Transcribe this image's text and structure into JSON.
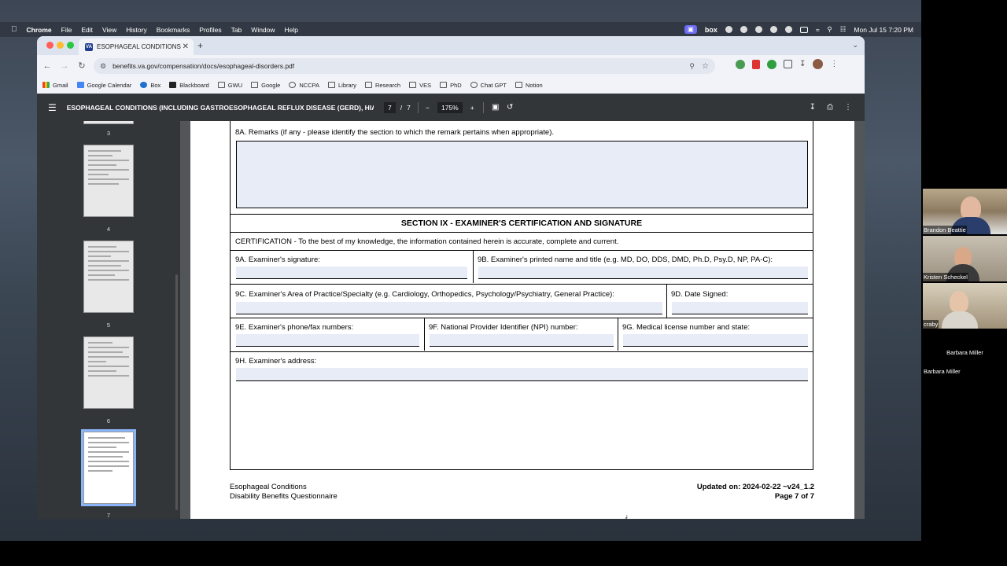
{
  "mac_menubar": {
    "app": "Chrome",
    "menus": [
      "File",
      "Edit",
      "View",
      "History",
      "Bookmarks",
      "Profiles",
      "Tab",
      "Window",
      "Help"
    ],
    "clock": "Mon Jul 15  7:20 PM",
    "box_label": "box"
  },
  "browser": {
    "tab_title": "ESOPHAGEAL CONDITIONS",
    "tab_favicon_text": "VA",
    "url": "benefits.va.gov/compensation/docs/esophageal-disorders.pdf",
    "bookmarks": [
      "Gmail",
      "Google Calendar",
      "Box",
      "Blackboard",
      "GWU",
      "Google",
      "NCCPA",
      "Library",
      "Research",
      "VES",
      "PhD",
      "Chat GPT",
      "Notion"
    ]
  },
  "pdf_toolbar": {
    "title": "ESOPHAGEAL CONDITIONS (INCLUDING GASTROESOPHAGEAL REFLUX DISEASE (GERD), HIA...",
    "current_page": "7",
    "page_sep": "/",
    "total_pages": "7",
    "zoom": "175%"
  },
  "thumbnails": [
    "3",
    "4",
    "5",
    "6",
    "7"
  ],
  "form": {
    "remarks_label": "8A. Remarks (if any - please identify the section to which the remark pertains when appropriate).",
    "section_title": "SECTION IX - EXAMINER'S CERTIFICATION AND SIGNATURE",
    "certification": "CERTIFICATION - To the best of my knowledge, the information contained herein is accurate, complete and current.",
    "f9a": "9A. Examiner's signature:",
    "f9b": "9B. Examiner's printed name and title (e.g. MD, DO, DDS, DMD, Ph.D, Psy.D, NP, PA-C):",
    "f9c": "9C. Examiner's Area of Practice/Specialty (e.g. Cardiology, Orthopedics, Psychology/Psychiatry, General Practice):",
    "f9d": "9D. Date Signed:",
    "f9e": "9E. Examiner's phone/fax numbers:",
    "f9f": "9F. National Provider Identifier (NPI) number:",
    "f9g": "9G. Medical license number and state:",
    "f9h": "9H. Examiner's address:"
  },
  "footer": {
    "left_line1": "Esophageal Conditions",
    "left_line2": "Disability Benefits Questionnaire",
    "right_line1": "Updated on: 2024-02-22 ~v24_1.2",
    "right_line2": "Page 7 of 7"
  },
  "video_participants": [
    {
      "name": "Brandon Beattie"
    },
    {
      "name": "Kristen Scheckel"
    },
    {
      "name": "craby"
    },
    {
      "name": "Barbara Miller",
      "label_center": "Barbara Miller"
    }
  ]
}
